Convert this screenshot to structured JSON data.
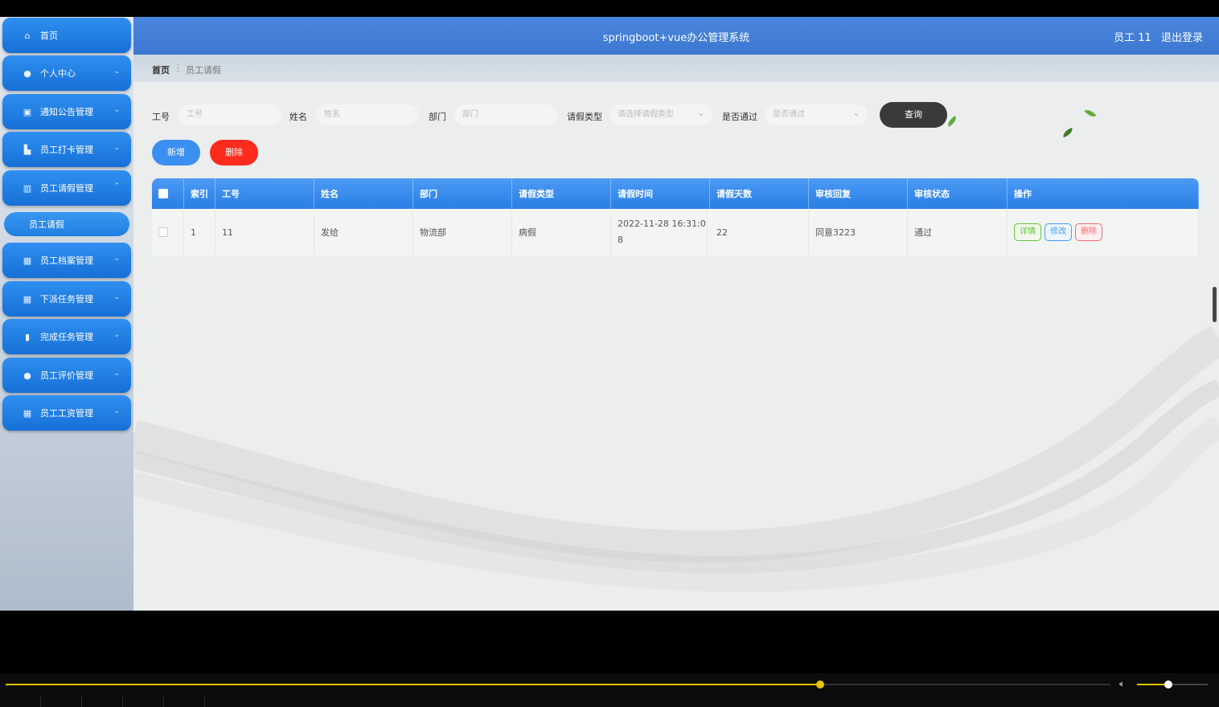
{
  "header": {
    "title": "springboot+vue办公管理系统",
    "user": "员工 11",
    "logout": "退出登录"
  },
  "breadcrumb": {
    "home": "首页",
    "separator": "⋮",
    "current": "员工请假"
  },
  "sidebar": {
    "items": [
      {
        "label": "首页",
        "icon": "home-icon",
        "glyph": "⌂",
        "chevron": ""
      },
      {
        "label": "个人中心",
        "icon": "user-icon",
        "glyph": "●",
        "chevron": "⌄"
      },
      {
        "label": "通知公告管理",
        "icon": "notice-icon",
        "glyph": "▣",
        "chevron": "⌄"
      },
      {
        "label": "员工打卡管理",
        "icon": "clock-in-icon",
        "glyph": "▙",
        "chevron": "⌄"
      },
      {
        "label": "员工请假管理",
        "icon": "leave-icon",
        "glyph": "▥",
        "chevron": "⌃"
      },
      {
        "label": "员工档案管理",
        "icon": "grid-icon",
        "glyph": "▦",
        "chevron": "⌄"
      },
      {
        "label": "下派任务管理",
        "icon": "grid-icon",
        "glyph": "▦",
        "chevron": "⌄"
      },
      {
        "label": "完成任务管理",
        "icon": "bar-chart-icon",
        "glyph": "▮",
        "chevron": "⌄"
      },
      {
        "label": "员工评价管理",
        "icon": "location-icon",
        "glyph": "●",
        "chevron": "⌄"
      },
      {
        "label": "员工工资管理",
        "icon": "grid-icon",
        "glyph": "▦",
        "chevron": "⌄"
      }
    ],
    "sub_item": "员工请假"
  },
  "search": {
    "id_label": "工号",
    "id_placeholder": "工号",
    "name_label": "姓名",
    "name_placeholder": "姓名",
    "dept_label": "部门",
    "dept_placeholder": "部门",
    "type_label": "请假类型",
    "type_placeholder": "请选择请假类型",
    "pass_label": "是否通过",
    "pass_placeholder": "是否通过",
    "query": "查询"
  },
  "actions": {
    "add": "新增",
    "delete": "删除"
  },
  "table": {
    "columns": [
      "索引",
      "工号",
      "姓名",
      "部门",
      "请假类型",
      "请假时间",
      "请假天数",
      "审核回复",
      "审核状态",
      "操作"
    ],
    "rows": [
      {
        "index": "1",
        "emp_id": "11",
        "name": "发给",
        "dept": "物流部",
        "type": "病假",
        "time": "2022-11-28 16:31:08",
        "days": "22",
        "reply": "同意3223",
        "status": "通过"
      }
    ],
    "ops": {
      "detail": "详情",
      "edit": "修改",
      "delete": "删除"
    }
  },
  "player": {
    "progress": 0.737,
    "volume": 0.44,
    "accent": "#e3c200"
  }
}
